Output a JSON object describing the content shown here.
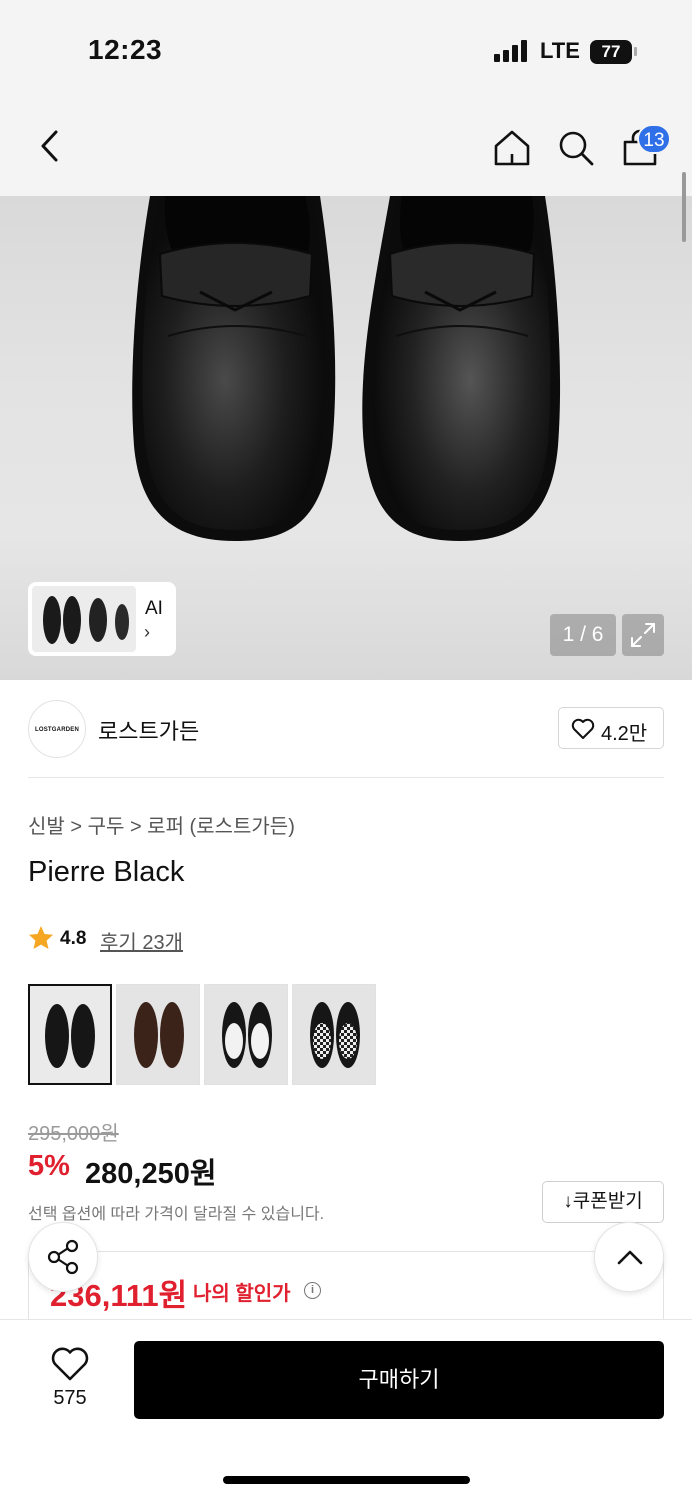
{
  "status": {
    "time": "12:23",
    "network": "LTE",
    "battery": "77"
  },
  "nav": {
    "cart_count": "13"
  },
  "gallery": {
    "ai_label": "AI",
    "ai_chevron": "›",
    "counter": "1 / 6"
  },
  "brand": {
    "logo_text": "LOSTGARDEN",
    "name": "로스트가든",
    "likes": "4.2만"
  },
  "product": {
    "breadcrumb": "신발 > 구두 > 로퍼 (로스트가든)",
    "title": "Pierre Black",
    "rating": "4.8",
    "reviews": "후기 23개",
    "color_options": [
      "black",
      "brown",
      "black-white",
      "checker"
    ]
  },
  "price": {
    "original": "295,000원",
    "discount_rate": "5%",
    "sale": "280,250원",
    "note": "선택 옵션에 따라 가격이 달라질 수 있습니다.",
    "coupon_label": "쿠폰받기",
    "coupon_icon": "↓",
    "member_price": "236,111원",
    "member_label": "나의 할인가",
    "info_icon": "i"
  },
  "actions": {
    "wish_count": "575",
    "buy_label": "구매하기"
  },
  "colors": {
    "accent_red": "#e1202f",
    "badge_blue": "#2f6fe8",
    "buy_black": "#000000"
  }
}
